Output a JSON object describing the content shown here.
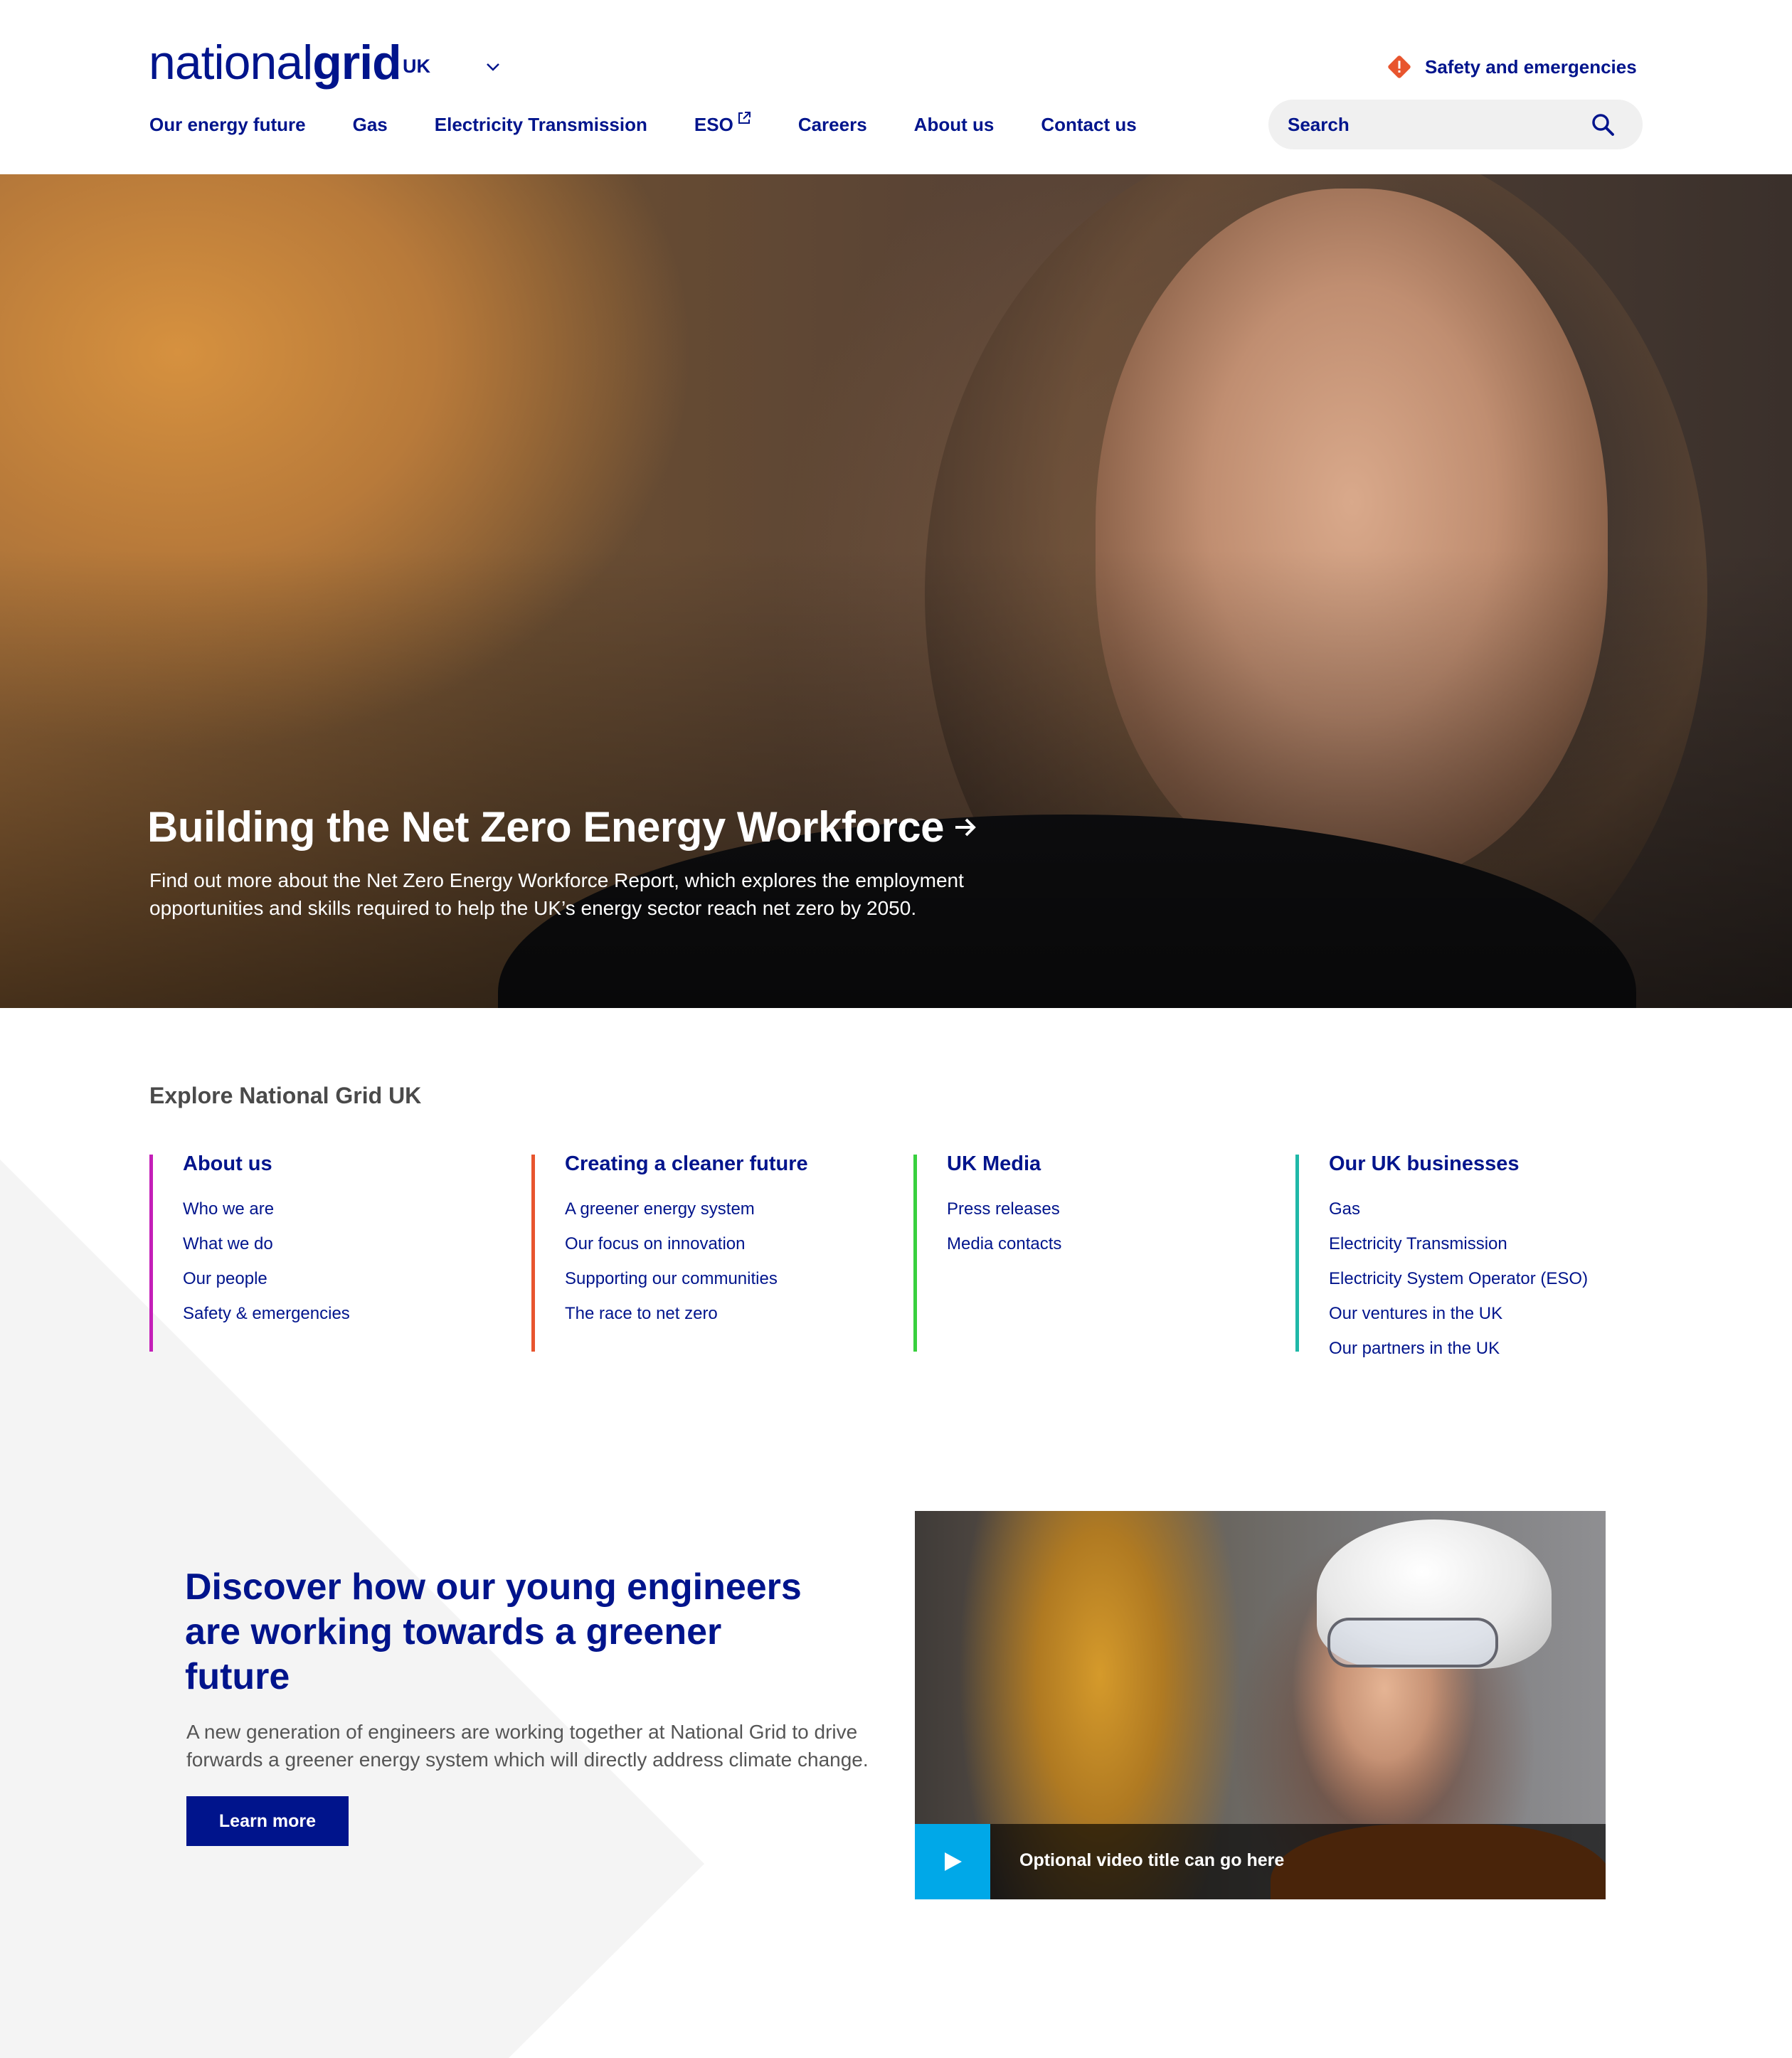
{
  "header": {
    "logo_part1": "national",
    "logo_part2": "grid",
    "region": "UK",
    "safety_label": "Safety and emergencies",
    "search_placeholder": "Search"
  },
  "nav": {
    "items": [
      {
        "label": "Our energy future"
      },
      {
        "label": "Gas"
      },
      {
        "label": "Electricity Transmission"
      },
      {
        "label": "ESO",
        "external": true
      },
      {
        "label": "Careers"
      },
      {
        "label": "About us"
      },
      {
        "label": "Contact us"
      }
    ]
  },
  "hero": {
    "title": "Building the Net Zero Energy Workforce",
    "description": "Find out more about the Net Zero Energy Workforce Report, which explores the employment opportunities and skills required to help the UK’s energy sector reach net zero by 2050."
  },
  "explore": {
    "heading": "Explore National Grid UK",
    "columns": [
      {
        "title": "About us",
        "accent": "#c41fb8",
        "links": [
          "Who we are",
          "What we do",
          "Our people",
          "Safety & emergencies"
        ]
      },
      {
        "title": "Creating a cleaner future",
        "accent": "#e8552e",
        "links": [
          "A greener energy system",
          "Our focus on innovation",
          "Supporting our communities",
          "The race to net zero"
        ]
      },
      {
        "title": "UK Media",
        "accent": "#38d03e",
        "links": [
          "Press releases",
          "Media contacts"
        ]
      },
      {
        "title": "Our UK businesses",
        "accent": "#1fb8a8",
        "links": [
          "Gas",
          "Electricity Transmission",
          "Electricity System Operator (ESO)",
          "Our ventures in the UK",
          "Our partners in the UK"
        ]
      }
    ]
  },
  "promo": {
    "title": "Discover how our young engineers are working towards a greener future",
    "description": "A new generation of engineers are working together at National Grid to drive forwards a greener energy system which will directly address climate change.",
    "button_label": "Learn more",
    "video_title": "Optional video title can go here"
  },
  "colors": {
    "brand": "#00148c",
    "safety": "#e8552e",
    "play": "#00a8e8"
  },
  "icons": [
    "chevron-down-icon",
    "warning-diamond-icon",
    "external-link-icon",
    "search-icon",
    "arrow-right-icon",
    "play-icon"
  ]
}
